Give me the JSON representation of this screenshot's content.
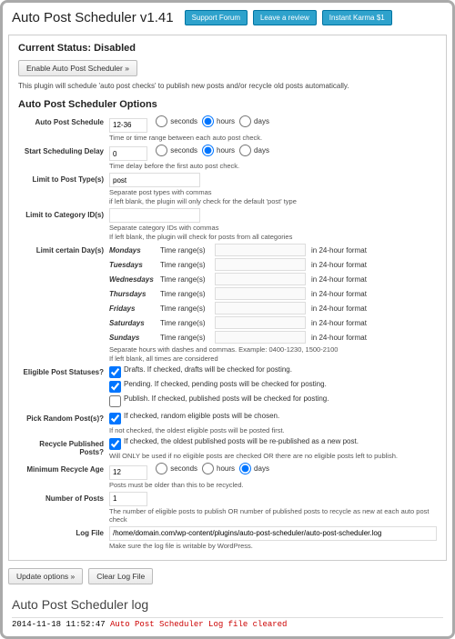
{
  "header": {
    "title": "Auto Post Scheduler v1.41",
    "buttons": {
      "forum": "Support Forum",
      "review": "Leave a review",
      "karma": "Instant Karma $1"
    }
  },
  "status": {
    "heading": "Current Status: Disabled",
    "enable_btn": "Enable Auto Post Scheduler »",
    "desc": "This plugin will schedule 'auto post checks' to publish new posts and/or recycle old posts automatically."
  },
  "opts_heading": "Auto Post Scheduler Options",
  "labels": {
    "schedule": "Auto Post Schedule",
    "delay": "Start Scheduling Delay",
    "types": "Limit to Post Type(s)",
    "cats": "Limit to Category ID(s)",
    "days": "Limit certain Day(s)",
    "statuses": "Eligible Post Statuses?",
    "random": "Pick Random Post(s)?",
    "recycle": "Recycle Published Posts?",
    "minage": "Minimum Recycle Age",
    "numposts": "Number of Posts",
    "logfile": "Log File"
  },
  "vals": {
    "schedule": "12-36",
    "delay": "0",
    "types": "post",
    "cats": "",
    "minage": "12",
    "numposts": "1",
    "logfile": "/home/domain.com/wp-content/plugins/auto-post-scheduler/auto-post-scheduler.log"
  },
  "units": {
    "seconds": "seconds",
    "hours": "hours",
    "days": "days"
  },
  "help": {
    "schedule": "Time or time range between each auto post check.",
    "delay": "Time delay before the first auto post check.",
    "types1": "Separate post types with commas",
    "types2": "if left blank, the plugin will only check for the default 'post' type",
    "cats1": "Separate category IDs with commas",
    "cats2": "If left blank, the plugin will check for posts from all categories",
    "days1": "Separate hours with dashes and commas. Example: 0400-1230, 1500-2100",
    "days2": "If left blank, all times are considered",
    "random1": "If checked, random eligible posts will be chosen.",
    "random2": "If not checked, the oldest eligible posts will be posted first.",
    "recycle1": "If checked, the oldest published posts will be re-published as a new post.",
    "recycle2": "Will ONLY be used if no eligible posts are checked OR there are no eligible posts left to publish.",
    "minage": "Posts must be older than this to be recycled.",
    "numposts": "The number of eligible posts to publish OR number of published posts to recycle as new at each auto post check",
    "logfile": "Make sure the log file is writable by WordPress."
  },
  "days": [
    "Mondays",
    "Tuesdays",
    "Wednesdays",
    "Thursdays",
    "Fridays",
    "Saturdays",
    "Sundays"
  ],
  "daylabels": {
    "tr": "Time range(s)",
    "fmt": "in 24-hour format"
  },
  "statuses": {
    "drafts": "Drafts. If checked, drafts will be checked for posting.",
    "pending": "Pending. If checked, pending posts will be checked for posting.",
    "publish": "Publish. If checked, published posts will be checked for posting."
  },
  "footer": {
    "update": "Update options »",
    "clear": "Clear Log File"
  },
  "log": {
    "heading": "Auto Post Scheduler log",
    "ts": "2014-11-18 11:52:47",
    "msg": "Auto Post Scheduler Log file cleared"
  }
}
